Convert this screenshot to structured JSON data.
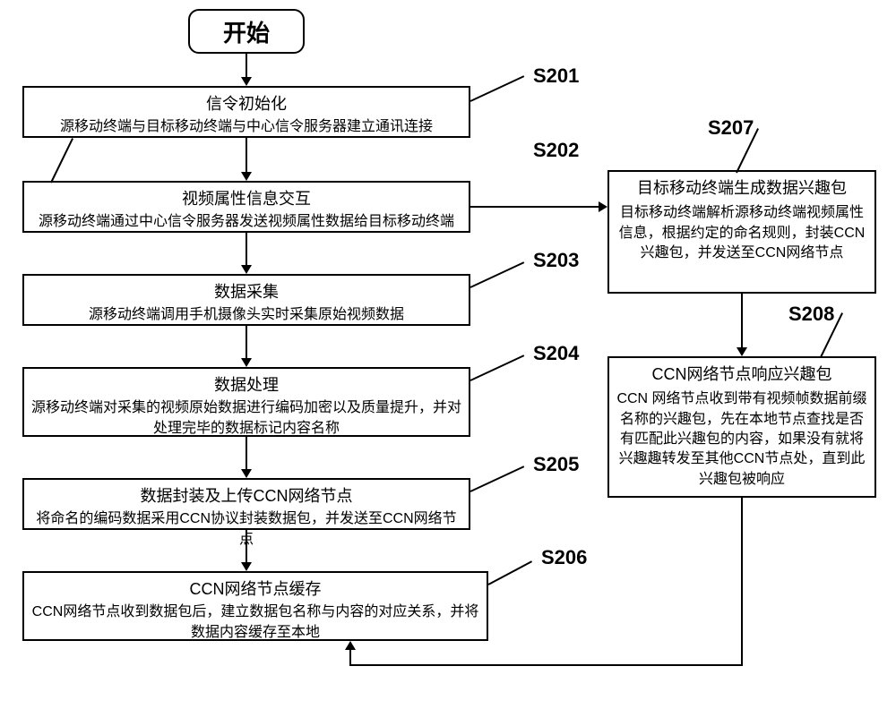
{
  "start": {
    "label": "开始"
  },
  "steps": {
    "s201": {
      "label": "S201",
      "title": "信令初始化",
      "desc": "源移动终端与目标移动终端与中心信令服务器建立通讯连接"
    },
    "s202": {
      "label": "S202",
      "title": "视频属性信息交互",
      "desc": "源移动终端通过中心信令服务器发送视频属性数据给目标移动终端"
    },
    "s203": {
      "label": "S203",
      "title": "数据采集",
      "desc": "源移动终端调用手机摄像头实时采集原始视频数据"
    },
    "s204": {
      "label": "S204",
      "title": "数据处理",
      "desc": "源移动终端对采集的视频原始数据进行编码加密以及质量提升，并对处理完毕的数据标记内容名称"
    },
    "s205": {
      "label": "S205",
      "title": "数据封装及上传CCN网络节点",
      "desc": "将命名的编码数据采用CCN协议封装数据包，并发送至CCN网络节点"
    },
    "s206": {
      "label": "S206",
      "title": "CCN网络节点缓存",
      "desc": "CCN网络节点收到数据包后，建立数据包名称与内容的对应关系，并将数据内容缓存至本地"
    },
    "s207": {
      "label": "S207",
      "title": "目标移动终端生成数据兴趣包",
      "desc": "目标移动终端解析源移动终端视频属性信息，根据约定的命名规则，封装CCN兴趣包，并发送至CCN网络节点"
    },
    "s208": {
      "label": "S208",
      "title": "CCN网络节点响应兴趣包",
      "desc": "CCN 网络节点收到带有视频帧数据前缀名称的兴趣包，先在本地节点查找是否有匹配此兴趣包的内容，如果没有就将兴趣趣转发至其他CCN节点处，直到此兴趣包被响应"
    }
  }
}
